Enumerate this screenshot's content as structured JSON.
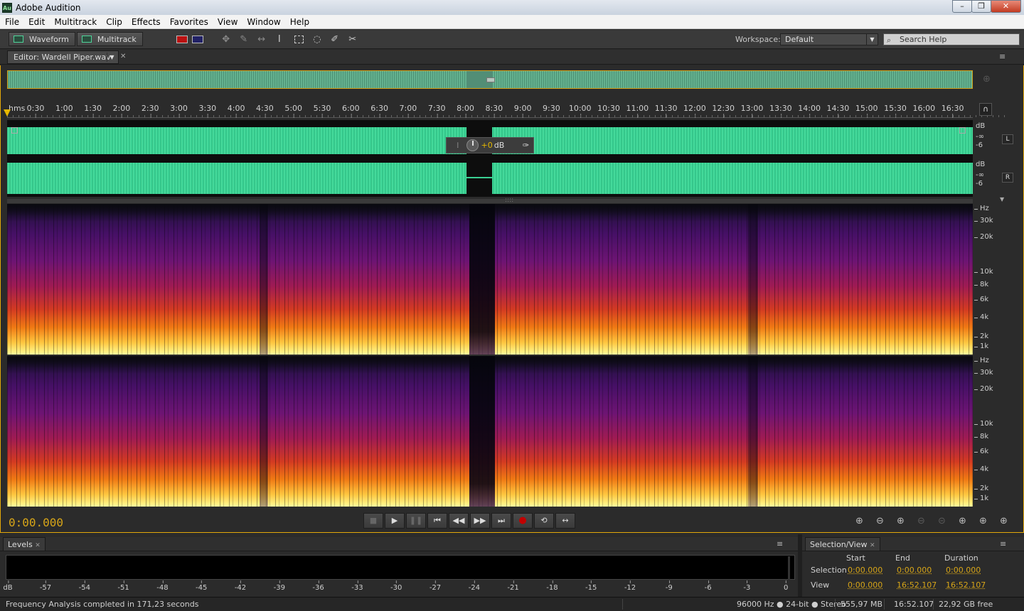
{
  "window": {
    "title": "Adobe Audition",
    "app_icon": "Au"
  },
  "menu": [
    "File",
    "Edit",
    "Multitrack",
    "Clip",
    "Effects",
    "Favorites",
    "View",
    "Window",
    "Help"
  ],
  "toolbar": {
    "waveform_label": "Waveform",
    "multitrack_label": "Multitrack",
    "workspace_label": "Workspace:",
    "workspace_value": "Default",
    "search_placeholder": "Search Help"
  },
  "editor": {
    "tab_label": "Editor: Wardell Piper.wav"
  },
  "ruler": {
    "unit": "hms",
    "ticks": [
      "0:30",
      "1:00",
      "1:30",
      "2:00",
      "2:30",
      "3:00",
      "3:30",
      "4:00",
      "4:30",
      "5:00",
      "5:30",
      "6:00",
      "6:30",
      "7:00",
      "7:30",
      "8:00",
      "8:30",
      "9:00",
      "9:30",
      "10:00",
      "10:30",
      "11:00",
      "11:30",
      "12:00",
      "12:30",
      "13:00",
      "13:30",
      "14:00",
      "14:30",
      "15:00",
      "15:30",
      "16:00",
      "16:30"
    ]
  },
  "channels": {
    "left": {
      "label": "L",
      "db_unit": "dB",
      "db_ticks": [
        "-∞",
        "-6"
      ]
    },
    "right": {
      "label": "R",
      "db_unit": "dB",
      "db_ticks": [
        "-∞",
        "-6"
      ]
    }
  },
  "hud": {
    "value": "+0",
    "unit": "dB"
  },
  "spectral": {
    "unit": "Hz",
    "ticks": [
      "30k",
      "20k",
      "10k",
      "8k",
      "6k",
      "4k",
      "2k",
      "1k"
    ]
  },
  "transport": {
    "time": "0:00.000"
  },
  "levels": {
    "tab_label": "Levels",
    "scale_unit": "dB",
    "scale": [
      "-57",
      "-54",
      "-51",
      "-48",
      "-45",
      "-42",
      "-39",
      "-36",
      "-33",
      "-30",
      "-27",
      "-24",
      "-21",
      "-18",
      "-15",
      "-12",
      "-9",
      "-6",
      "-3",
      "0"
    ]
  },
  "selection_view": {
    "tab_label": "Selection/View",
    "headers": {
      "start": "Start",
      "end": "End",
      "duration": "Duration"
    },
    "rows": {
      "selection": {
        "label": "Selection",
        "start": "0:00.000",
        "end": "0:00.000",
        "duration": "0:00.000"
      },
      "view": {
        "label": "View",
        "start": "0:00.000",
        "end": "16:52.107",
        "duration": "16:52.107"
      }
    }
  },
  "status": {
    "message": "Frequency Analysis completed in 171,23 seconds",
    "format": "96000 Hz ● 24-bit ● Stereo",
    "size": "555,97 MB",
    "duration": "16:52.107",
    "free": "22,92 GB free"
  },
  "colors": {
    "accent": "#e3a80a",
    "waveform": "#4fe3a3",
    "time_text": "#d7a518"
  }
}
